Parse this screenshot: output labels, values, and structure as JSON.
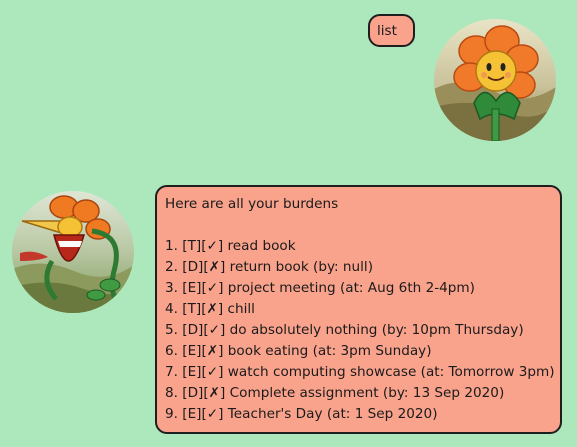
{
  "user_message": {
    "text": "list",
    "avatar_icon": "flower-character-happy-icon"
  },
  "bot_message": {
    "avatar_icon": "flower-character-screaming-icon",
    "header": "Here are all your burdens",
    "tasks": [
      "1. [T][✓] read book",
      "2. [D][✗] return book (by: null)",
      "3. [E][✓] project meeting (at: Aug 6th 2-4pm)",
      "4. [T][✗] chill",
      "5. [D][✓] do absolutely nothing (by: 10pm Thursday)",
      "6. [E][✗] book eating (at: 3pm Sunday)",
      "7. [E][✓] watch computing showcase (at: Tomorrow 3pm)",
      "8. [D][✗] Complete assignment (by: 13 Sep 2020)",
      "9. [E][✓] Teacher's Day (at: 1 Sep 2020)"
    ]
  },
  "colors": {
    "background": "#ade8bd",
    "bubble": "#f9a28c",
    "bubble_border": "#1e1e1e"
  }
}
